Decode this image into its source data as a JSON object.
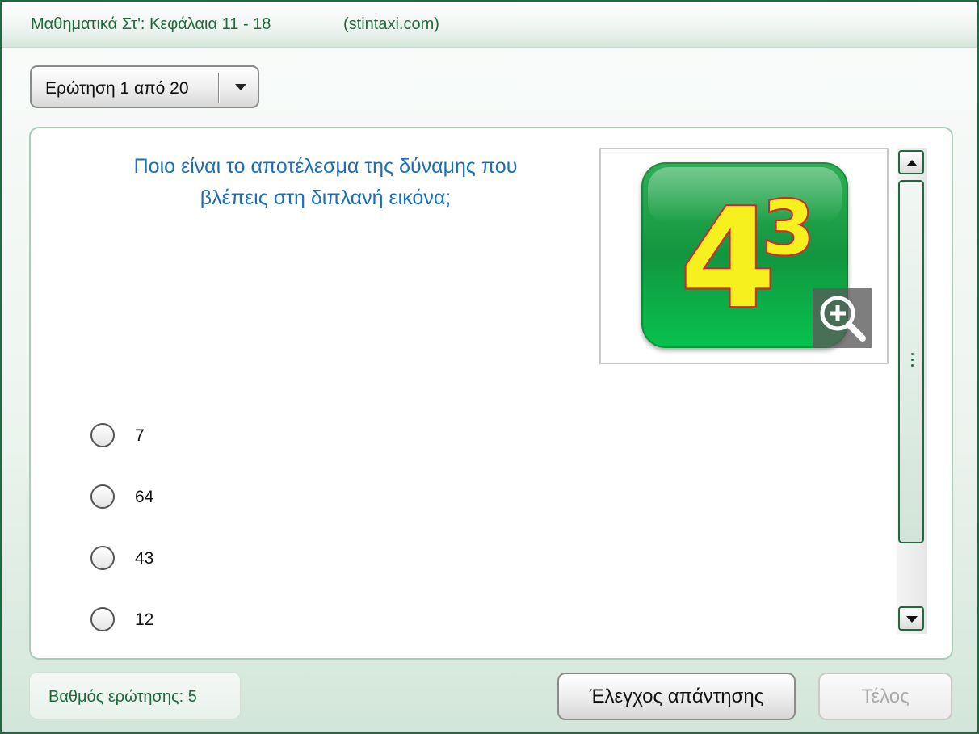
{
  "header": {
    "title": "Μαθηματικά Στ':  Κεφάλαια 11 - 18",
    "site": "(stintaxi.com)"
  },
  "question_selector": {
    "label": "Ερώτηση 1 από 20"
  },
  "question": {
    "line1": "Ποιο είναι το αποτέλεσμα της δύναμης που",
    "line2": "βλέπεις στη διπλανή εικόνα;",
    "image": {
      "base": "4",
      "exponent": "3",
      "zoom_icon": "zoom-in-icon"
    }
  },
  "options": [
    {
      "label": "7"
    },
    {
      "label": "64"
    },
    {
      "label": "43"
    },
    {
      "label": "12"
    }
  ],
  "footer": {
    "score": "Βαθμός ερώτησης: 5",
    "check_button": "Έλεγχος απάντησης",
    "end_button": "Τέλος"
  },
  "colors": {
    "accent_green": "#1d6a3a",
    "question_blue": "#1a6fb8",
    "tile_green": "#12963f",
    "numeral_yellow": "#f7f01f",
    "numeral_outline": "#d8232a"
  }
}
